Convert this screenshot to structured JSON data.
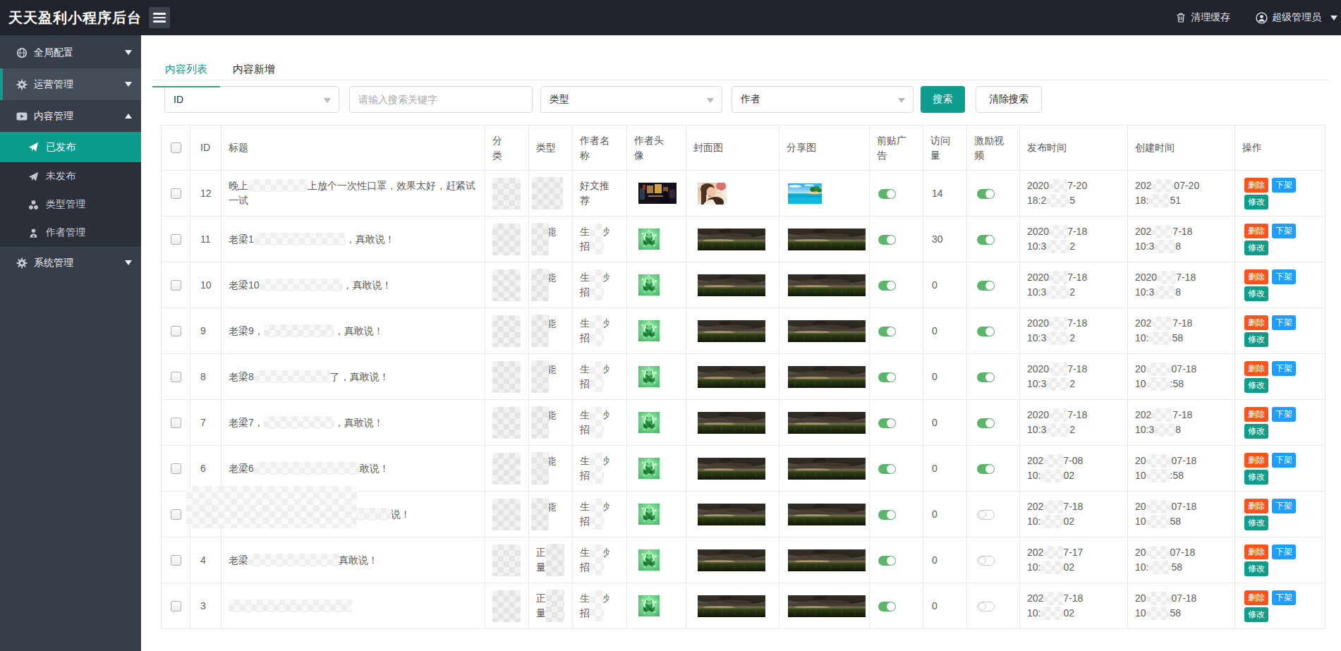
{
  "colors": {
    "topbar_bg": "#20232b",
    "sidebar_bg": "#373e4a",
    "submenu_bg": "#2a2f38",
    "accent_teal": "#0a9d8d",
    "tab_underline_green": "#35a97a",
    "toggle_on_green": "#5bb56a",
    "delete_red": "#fa541c",
    "offline_blue": "#1e9fff",
    "modify_teal": "#0f9d8a"
  },
  "topbar": {
    "title": "天天盈利小程序后台",
    "clear_cache": "清理缓存",
    "admin": "超级管理员"
  },
  "sidebar": {
    "items": [
      {
        "label": "全局配置",
        "icon": "globe-icon",
        "caret": "down",
        "highlight": false
      },
      {
        "label": "运营管理",
        "icon": "gear-icon",
        "caret": "down",
        "highlight": true
      },
      {
        "label": "内容管理",
        "icon": "video-icon",
        "caret": "up",
        "highlight": false,
        "children": [
          {
            "label": "已发布",
            "icon": "send-icon",
            "active": true
          },
          {
            "label": "未发布",
            "icon": "send-icon",
            "active": false
          },
          {
            "label": "类型管理",
            "icon": "cubes-icon",
            "active": false
          },
          {
            "label": "作者管理",
            "icon": "author-icon",
            "active": false
          }
        ]
      },
      {
        "label": "系统管理",
        "icon": "gear-icon",
        "caret": "down",
        "highlight": false
      }
    ]
  },
  "tabs": [
    {
      "label": "内容列表",
      "active": true
    },
    {
      "label": "内容新增",
      "active": false
    }
  ],
  "filters": {
    "id_select": "ID",
    "keyword_placeholder": "请输入搜索关键字",
    "type_select": "类型",
    "author_select": "作者",
    "search_button": "搜索",
    "clear_button": "清除搜索"
  },
  "table": {
    "headers": [
      "ID",
      "标题",
      "分\n类",
      "类型",
      "作者名\n称",
      "作者头\n像",
      "封面图",
      "分享图",
      "前贴广\n告",
      "访问\n量",
      "激励视\n频",
      "发布时间",
      "创建时间",
      "操作"
    ],
    "actions": {
      "delete": "删除",
      "offline": "下架",
      "modify": "修改"
    },
    "rows": [
      {
        "id": "12",
        "id_censored": false,
        "title": [
          {
            "t": "晚上"
          },
          {
            "m": 84
          },
          {
            "t": "上放个一次性口罩，效果太好，赶紧试一试"
          }
        ],
        "type": "",
        "type_censor": "full",
        "author": "好文推荐",
        "author_censored": false,
        "avatar": "night-city-photo",
        "cover": "woman-photo",
        "share": "beach-photo",
        "pre_ad": true,
        "visits": "14",
        "reward": true,
        "publish": {
          "line1": [
            {
              "t": "2020"
            },
            {
              "m": 26
            },
            {
              "t": "7-20"
            }
          ],
          "line2": [
            {
              "t": "18:2"
            },
            {
              "m": 33
            },
            {
              "t": "5"
            }
          ]
        },
        "create": {
          "line1": [
            {
              "t": "202"
            },
            {
              "m": 32
            },
            {
              "t": "07-20"
            }
          ],
          "line2": [
            {
              "t": "18:"
            },
            {
              "m": 30
            },
            {
              "t": "51"
            }
          ]
        }
      },
      {
        "id": "11",
        "id_censored": false,
        "title": [
          {
            "t": "老梁1"
          },
          {
            "m": 130
          },
          {
            "t": "，真敢说！"
          }
        ],
        "type": "正能量",
        "type_censor": "left",
        "author": "生活妙招",
        "author_censored": true,
        "avatar": "gift-box-illustration",
        "cover": "field-photo",
        "share": "field-photo",
        "pre_ad": true,
        "visits": "30",
        "reward": true,
        "publish": {
          "line1": [
            {
              "t": "2020"
            },
            {
              "m": 26
            },
            {
              "t": "7-18"
            }
          ],
          "line2": [
            {
              "t": "10:3"
            },
            {
              "m": 33
            },
            {
              "t": "2"
            }
          ]
        },
        "create": {
          "line1": [
            {
              "t": "202"
            },
            {
              "m": 30
            },
            {
              "t": "7-18"
            }
          ],
          "line2": [
            {
              "t": "10:3"
            },
            {
              "m": 30
            },
            {
              "t": "8"
            }
          ]
        }
      },
      {
        "id": "10",
        "id_censored": false,
        "title": [
          {
            "t": "老梁10"
          },
          {
            "m": 118
          },
          {
            "t": "，真敢说！"
          }
        ],
        "type": "正能量",
        "type_censor": "left",
        "author": "生活妙招",
        "author_censored": true,
        "avatar": "gift-box-illustration",
        "cover": "field-photo",
        "share": "field-photo",
        "pre_ad": true,
        "visits": "0",
        "reward": true,
        "publish": {
          "line1": [
            {
              "t": "2020"
            },
            {
              "m": 26
            },
            {
              "t": "7-18"
            }
          ],
          "line2": [
            {
              "t": "10:3"
            },
            {
              "m": 33
            },
            {
              "t": "2"
            }
          ]
        },
        "create": {
          "line1": [
            {
              "t": "2020"
            },
            {
              "m": 27
            },
            {
              "t": "7-18"
            }
          ],
          "line2": [
            {
              "t": "10:3"
            },
            {
              "m": 30
            },
            {
              "t": "8"
            }
          ]
        }
      },
      {
        "id": "9",
        "id_censored": false,
        "title": [
          {
            "t": "老梁9，"
          },
          {
            "m": 100
          },
          {
            "t": "，真敢说！"
          }
        ],
        "type": "正能量",
        "type_censor": "left",
        "author": "生活妙招",
        "author_censored": true,
        "avatar": "gift-box-illustration",
        "cover": "field-photo",
        "share": "field-photo",
        "pre_ad": true,
        "visits": "0",
        "reward": true,
        "publish": {
          "line1": [
            {
              "t": "2020"
            },
            {
              "m": 26
            },
            {
              "t": "7-18"
            }
          ],
          "line2": [
            {
              "t": "10:3"
            },
            {
              "m": 33
            },
            {
              "t": "2"
            }
          ]
        },
        "create": {
          "line1": [
            {
              "t": "202"
            },
            {
              "m": 30
            },
            {
              "t": "7-18"
            }
          ],
          "line2": [
            {
              "t": "10:"
            },
            {
              "m": 33
            },
            {
              "t": "58"
            }
          ]
        }
      },
      {
        "id": "8",
        "id_censored": false,
        "title": [
          {
            "t": "老梁8"
          },
          {
            "m": 108
          },
          {
            "t": "了，真敢说！"
          }
        ],
        "type": "正能量",
        "type_censor": "left",
        "author": "生活妙招",
        "author_censored": true,
        "avatar": "gift-box-illustration",
        "cover": "field-photo",
        "share": "field-photo",
        "pre_ad": true,
        "visits": "0",
        "reward": true,
        "publish": {
          "line1": [
            {
              "t": "2020"
            },
            {
              "m": 26
            },
            {
              "t": "7-18"
            }
          ],
          "line2": [
            {
              "t": "10:3"
            },
            {
              "m": 33
            },
            {
              "t": "2"
            }
          ]
        },
        "create": {
          "line1": [
            {
              "t": "20"
            },
            {
              "m": 36
            },
            {
              "t": "07-18"
            }
          ],
          "line2": [
            {
              "t": "10"
            },
            {
              "m": 34
            },
            {
              "t": ":58"
            }
          ]
        }
      },
      {
        "id": "7",
        "id_censored": false,
        "title": [
          {
            "t": "老梁7，"
          },
          {
            "m": 100
          },
          {
            "t": "，真敢说！"
          }
        ],
        "type": "正能量",
        "type_censor": "left",
        "author": "生活妙招",
        "author_censored": true,
        "avatar": "gift-box-illustration",
        "cover": "field-photo",
        "share": "field-photo",
        "pre_ad": true,
        "visits": "0",
        "reward": true,
        "publish": {
          "line1": [
            {
              "t": "2020"
            },
            {
              "m": 26
            },
            {
              "t": "7-18"
            }
          ],
          "line2": [
            {
              "t": "10:3"
            },
            {
              "m": 33
            },
            {
              "t": "2"
            }
          ]
        },
        "create": {
          "line1": [
            {
              "t": "202"
            },
            {
              "m": 30
            },
            {
              "t": "7-18"
            }
          ],
          "line2": [
            {
              "t": "10:3"
            },
            {
              "m": 30
            },
            {
              "t": "8"
            }
          ]
        }
      },
      {
        "id": "6",
        "id_censored": false,
        "title": [
          {
            "t": "老梁6"
          },
          {
            "m": 150
          },
          {
            "t": "敢说！"
          }
        ],
        "type": "正能量",
        "type_censor": "left",
        "author": "生活妙招",
        "author_censored": true,
        "avatar": "gift-box-illustration",
        "cover": "field-photo",
        "share": "field-photo",
        "pre_ad": true,
        "visits": "0",
        "reward": true,
        "publish": {
          "line1": [
            {
              "t": "202"
            },
            {
              "m": 28
            },
            {
              "t": "7-08"
            }
          ],
          "line2": [
            {
              "t": "10:"
            },
            {
              "m": 32
            },
            {
              "t": "02"
            }
          ]
        },
        "create": {
          "line1": [
            {
              "t": "20"
            },
            {
              "m": 36
            },
            {
              "t": "07-18"
            }
          ],
          "line2": [
            {
              "t": "10"
            },
            {
              "m": 34
            },
            {
              "t": ":58"
            }
          ]
        }
      },
      {
        "id": "",
        "id_censored": true,
        "title": [
          {
            "m": 230
          },
          {
            "t": "说！"
          }
        ],
        "type": "正能量",
        "type_censor": "left",
        "author": "生活妙招",
        "author_censored": true,
        "avatar": "gift-box-illustration",
        "cover": "field-photo",
        "share": "field-photo",
        "pre_ad": true,
        "visits": "0",
        "reward": false,
        "publish": {
          "line1": [
            {
              "t": "202"
            },
            {
              "m": 28
            },
            {
              "t": "7-18"
            }
          ],
          "line2": [
            {
              "t": "10:"
            },
            {
              "m": 32
            },
            {
              "t": "02"
            }
          ]
        },
        "create": {
          "line1": [
            {
              "t": "20"
            },
            {
              "m": 36
            },
            {
              "t": "07-18"
            }
          ],
          "line2": [
            {
              "t": "10"
            },
            {
              "m": 34
            },
            {
              "t": "58"
            }
          ]
        }
      },
      {
        "id": "4",
        "id_censored": false,
        "title": [
          {
            "t": "老梁"
          },
          {
            "m": 128
          },
          {
            "t": "真敢说！"
          }
        ],
        "type": "正能量",
        "type_censor": "right",
        "author": "生活妙招",
        "author_censored": true,
        "avatar": "gift-box-illustration",
        "cover": "field-photo",
        "share": "field-photo",
        "pre_ad": true,
        "visits": "0",
        "reward": false,
        "publish": {
          "line1": [
            {
              "t": "202"
            },
            {
              "m": 28
            },
            {
              "t": "7-17"
            }
          ],
          "line2": [
            {
              "t": "10:"
            },
            {
              "m": 32
            },
            {
              "t": "02"
            }
          ]
        },
        "create": {
          "line1": [
            {
              "t": "20"
            },
            {
              "m": 34
            },
            {
              "t": "07-18"
            }
          ],
          "line2": [
            {
              "t": "10:"
            },
            {
              "m": 32
            },
            {
              "t": "58"
            }
          ]
        }
      },
      {
        "id": "3",
        "id_censored": false,
        "title": [
          {
            "m": 175
          }
        ],
        "type": "正能量",
        "type_censor": "right",
        "author": "生活妙招",
        "author_censored": true,
        "avatar": "gift-box-illustration",
        "cover": "field-photo",
        "share": "field-photo",
        "pre_ad": true,
        "visits": "0",
        "reward": false,
        "publish": {
          "line1": [
            {
              "t": "202"
            },
            {
              "m": 28
            },
            {
              "t": "7-18"
            }
          ],
          "line2": [
            {
              "t": "10:"
            },
            {
              "m": 32
            },
            {
              "t": "02"
            }
          ]
        },
        "create": {
          "line1": [
            {
              "t": "20"
            },
            {
              "m": 36
            },
            {
              "t": "07-18"
            }
          ],
          "line2": [
            {
              "t": "10"
            },
            {
              "m": 34
            },
            {
              "t": "58"
            }
          ]
        }
      }
    ]
  }
}
